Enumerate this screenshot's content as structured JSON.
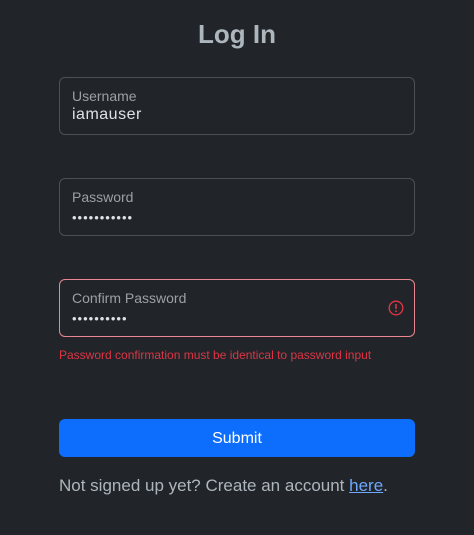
{
  "title": "Log In",
  "username": {
    "label": "Username",
    "value": "iamauser"
  },
  "password": {
    "label": "Password",
    "value": "•••••••••••"
  },
  "confirm_password": {
    "label": "Confirm Password",
    "value": "••••••••••",
    "icon": "exclamation-circle-icon",
    "error": "Password confirmation must be identical to password input"
  },
  "submit_label": "Submit",
  "signup": {
    "prefix": "Not signed up yet? Create an account ",
    "link_text": "here",
    "suffix": "."
  },
  "colors": {
    "background": "#212529",
    "primary": "#0d6efd",
    "danger": "#dc3545",
    "invalid_border": "#ea868f"
  }
}
